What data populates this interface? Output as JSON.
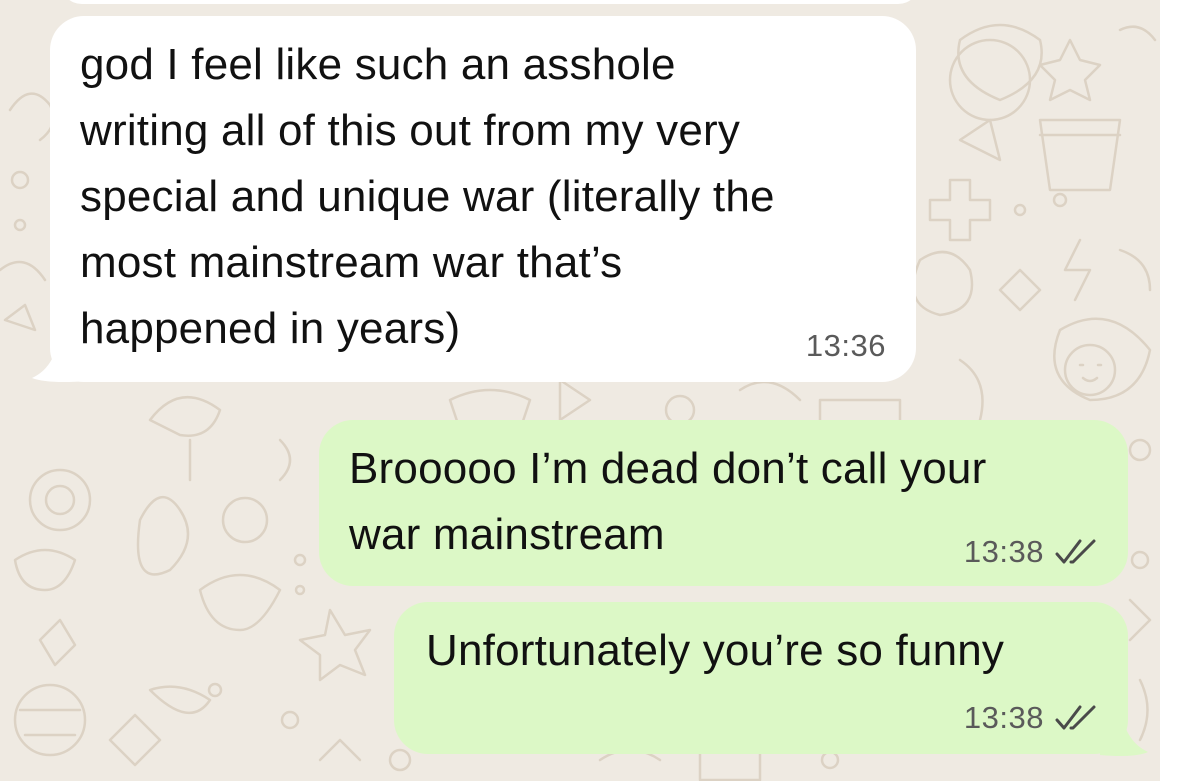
{
  "chat": {
    "messages": [
      {
        "direction": "incoming",
        "text": "god I feel like such an asshole\nwriting all of this out from my very\nspecial and unique war (literally the\nmost mainstream war that’s\nhappened in years)",
        "time": "13:36"
      },
      {
        "direction": "outgoing",
        "text": "Brooooo I’m dead don’t call your\nwar mainstream",
        "time": "13:38",
        "status_icon": "double-check-icon"
      },
      {
        "direction": "outgoing",
        "text": "Unfortunately you’re so funny",
        "time": "13:38",
        "status_icon": "double-check-icon"
      }
    ]
  },
  "colors": {
    "wallpaper": "#efeae2",
    "incoming_bubble": "#ffffff",
    "outgoing_bubble": "#dcf8c6",
    "text": "#111111",
    "timestamp": "#5a5a5a"
  }
}
